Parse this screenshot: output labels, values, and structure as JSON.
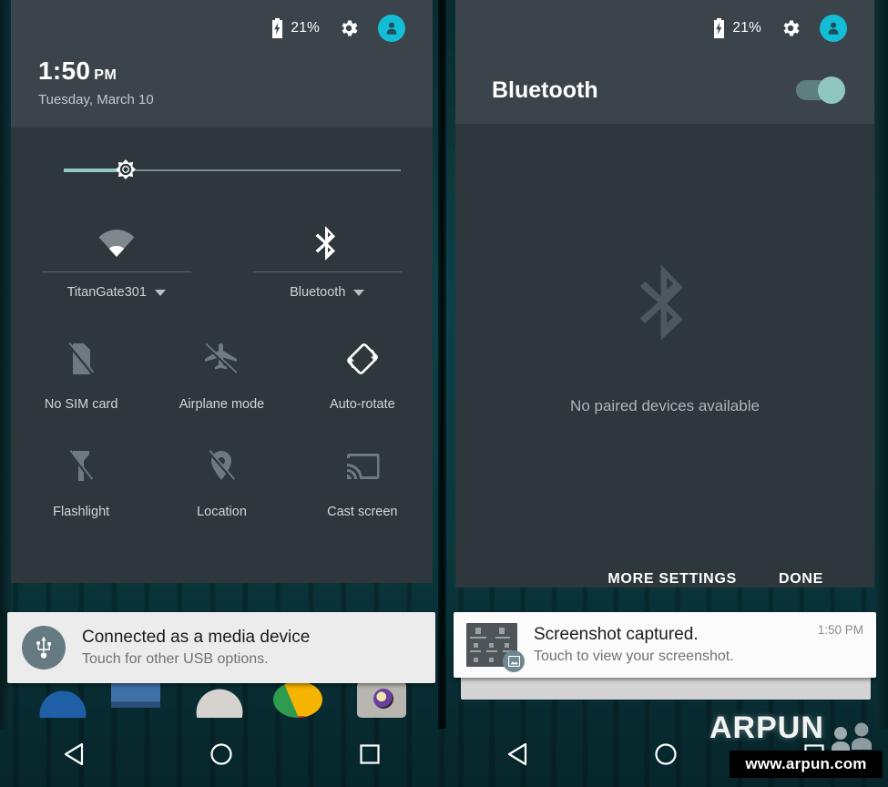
{
  "status_bar": {
    "battery_percent": "21%",
    "battery_icon": "battery-charging-icon",
    "settings_icon": "gear-icon",
    "avatar_icon": "user-avatar-icon",
    "accent_color": "#14bdd6"
  },
  "left_panel": {
    "clock": {
      "time": "1:50",
      "ampm": "PM",
      "date": "Tuesday, March 10"
    },
    "brightness": {
      "name": "brightness-slider",
      "icon": "brightness-icon",
      "value_percent": 18,
      "fill_color": "#93c7bf",
      "track_color": "#7f8b90"
    },
    "big_tiles": [
      {
        "label": "TitanGate301",
        "icon": "wifi-icon",
        "has_caret": true
      },
      {
        "label": "Bluetooth",
        "icon": "bluetooth-icon",
        "has_caret": true
      }
    ],
    "small_tiles": [
      {
        "label": "No SIM card",
        "icon": "sim-card-off-icon"
      },
      {
        "label": "Airplane mode",
        "icon": "airplane-icon"
      },
      {
        "label": "Auto-rotate",
        "icon": "auto-rotate-icon"
      },
      {
        "label": "Flashlight",
        "icon": "flashlight-off-icon"
      },
      {
        "label": "Location",
        "icon": "location-off-icon"
      },
      {
        "label": "Cast screen",
        "icon": "cast-screen-icon"
      }
    ]
  },
  "right_panel": {
    "title": "Bluetooth",
    "toggle": {
      "name": "bluetooth-toggle",
      "state": "on",
      "on_color": "#8fc7bf"
    },
    "empty_state": {
      "icon": "bluetooth-icon-large",
      "text": "No paired devices available"
    },
    "actions": [
      {
        "label": "MORE SETTINGS",
        "name": "more-settings-button"
      },
      {
        "label": "DONE",
        "name": "done-button"
      }
    ]
  },
  "notifications": [
    {
      "name": "usb-notification",
      "icon": "usb-icon",
      "title": "Connected as a media device",
      "subtitle": "Touch for other USB options."
    },
    {
      "name": "screenshot-notification",
      "icon": "screenshot-thumbnail",
      "badge_icon": "image-icon",
      "title": "Screenshot captured.",
      "subtitle": "Touch to view your screenshot.",
      "time": "1:50 PM"
    }
  ],
  "nav_bar": {
    "back": "back-triangle-icon",
    "home": "home-circle-icon",
    "recents": "recents-square-icon"
  },
  "watermark": {
    "brand": "ARPUN",
    "url": "www.arpun.com"
  }
}
